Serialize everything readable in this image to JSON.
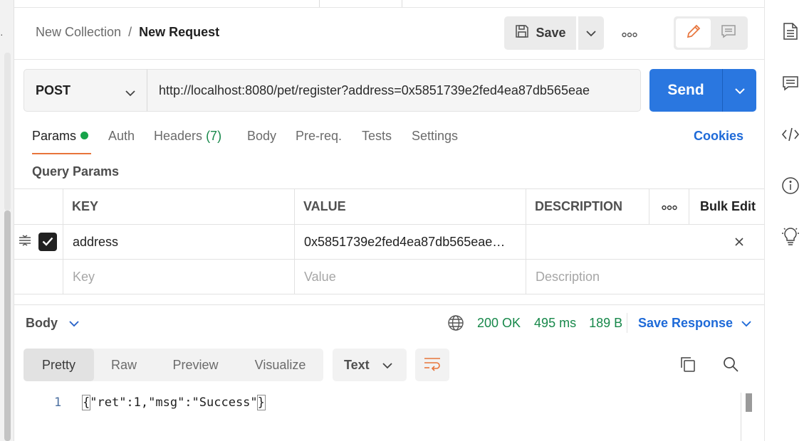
{
  "breadcrumb": {
    "collection": "New Collection",
    "separator": "/",
    "request": "New Request"
  },
  "toolbar": {
    "save_label": "Save"
  },
  "request": {
    "method": "POST",
    "url": "http://localhost:8080/pet/register?address=0x5851739e2fed4ea87db565eae",
    "send_label": "Send"
  },
  "tabs": {
    "params": "Params",
    "auth": "Auth",
    "headers": "Headers",
    "headers_count": "(7)",
    "body": "Body",
    "prereq": "Pre-req.",
    "tests": "Tests",
    "settings": "Settings",
    "cookies": "Cookies"
  },
  "query_params": {
    "label": "Query Params",
    "columns": {
      "key": "KEY",
      "value": "VALUE",
      "description": "DESCRIPTION",
      "bulk_edit": "Bulk Edit"
    },
    "rows": [
      {
        "key": "address",
        "value": "0x5851739e2fed4ea87db565eae…",
        "description": "",
        "checked": true
      }
    ],
    "placeholders": {
      "key": "Key",
      "value": "Value",
      "description": "Description"
    }
  },
  "response": {
    "body_label": "Body",
    "status": "200 OK",
    "time": "495 ms",
    "size": "189 B",
    "save_label": "Save Response",
    "view_tabs": [
      "Pretty",
      "Raw",
      "Preview",
      "Visualize"
    ],
    "active_view": "Pretty",
    "format": "Text",
    "lines": [
      {
        "number": "1",
        "open": "{",
        "content": "\"ret\":1,\"msg\":\"Success\"",
        "close": "}"
      }
    ]
  },
  "colors": {
    "accent": "#e8743b",
    "primary": "#2a77e0",
    "success": "#17884a",
    "link": "#1e6ad8"
  },
  "icons": {
    "save": "floppy-disk-icon",
    "more": "ellipsis-icon",
    "edit": "pencil-icon",
    "comment": "comment-icon",
    "docs": "document-icon",
    "comments": "chat-icon",
    "code": "code-icon",
    "info": "info-icon",
    "bulb": "lightbulb-icon",
    "globe": "globe-icon",
    "wrap": "wrap-lines-icon",
    "copy": "copy-icon",
    "search": "search-icon"
  }
}
